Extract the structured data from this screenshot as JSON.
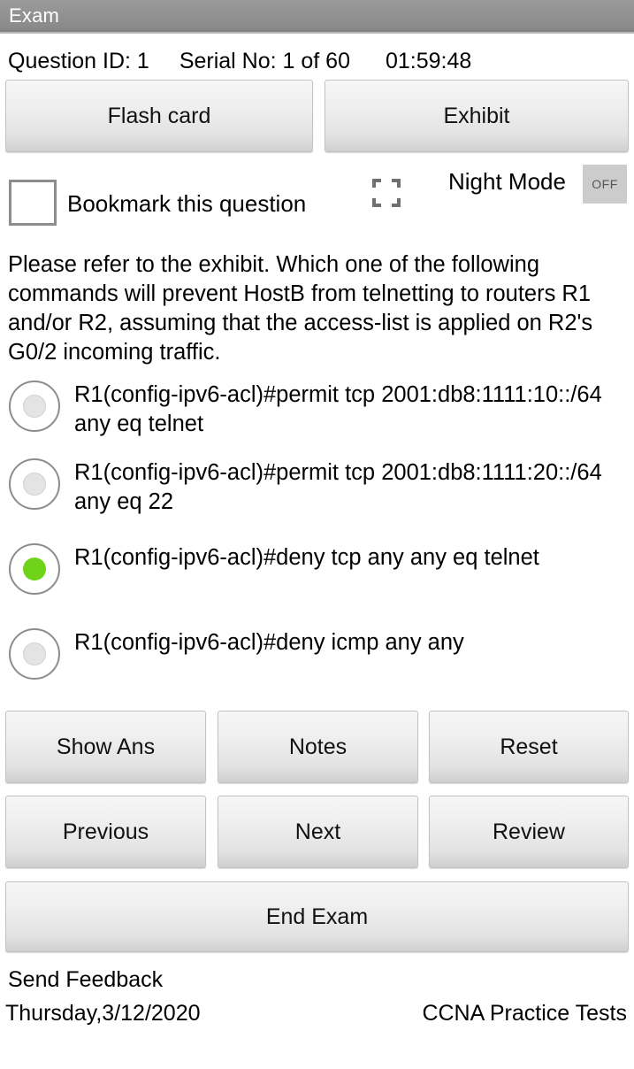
{
  "window": {
    "title": "Exam"
  },
  "info": {
    "question_id": "Question ID: 1",
    "serial_no": "Serial No: 1 of 60",
    "timer": "01:59:48"
  },
  "top_actions": {
    "flash_card": "Flash card",
    "exhibit": "Exhibit"
  },
  "controls": {
    "bookmark_label": "Bookmark this question",
    "bookmark_checked": false,
    "fullscreen_icon": "fullscreen-expand-icon",
    "night_mode_label": "Night Mode",
    "night_mode_state": "OFF"
  },
  "question": {
    "text": "Please refer to the exhibit. Which one of the following commands will prevent HostB\nfrom telnetting to routers R1 and/or R2, assuming that the access-list is applied on R2's G0/2 incoming traffic."
  },
  "options": [
    {
      "id": "option-a",
      "text": "R1(config-ipv6-acl)#permit tcp 2001:db8:1111:10::/64 any eq telnet",
      "selected": false
    },
    {
      "id": "option-b",
      "text": "R1(config-ipv6-acl)#permit tcp 2001:db8:1111:20::/64 any eq 22",
      "selected": false
    },
    {
      "id": "option-c",
      "text": "R1(config-ipv6-acl)#deny tcp any any eq telnet",
      "selected": true
    },
    {
      "id": "option-d",
      "text": "R1(config-ipv6-acl)#deny icmp any any",
      "selected": false
    }
  ],
  "actions": {
    "show_ans": "Show Ans",
    "notes": "Notes",
    "reset": "Reset",
    "previous": "Previous",
    "next": "Next",
    "review": "Review",
    "end_exam": "End Exam"
  },
  "footer": {
    "send_feedback": "Send Feedback",
    "date": "Thursday,3/12/2020",
    "brand": "CCNA Practice Tests"
  },
  "colors": {
    "titlebar": "#909090",
    "selected_radio": "#6fd319",
    "button_face": "#e8e8e8",
    "toggle_bg": "#cccccc"
  }
}
